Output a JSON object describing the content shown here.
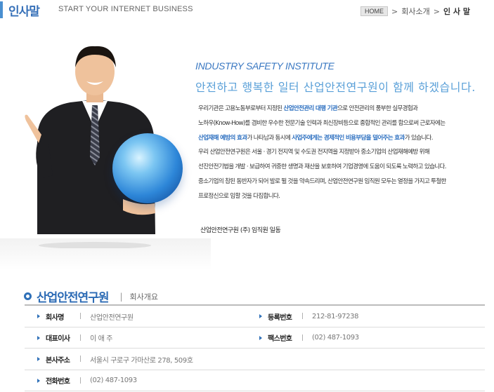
{
  "header": {
    "title": "인사말",
    "subtitle": "START YOUR INTERNET BUSINESS",
    "breadcrumb": {
      "home": "HOME",
      "parent": "회사소개",
      "current": "인 사 말"
    }
  },
  "hero": {
    "institute": "INDUSTRY SAFETY INSTITUTE",
    "headline": "안전하고 행복한 일터 산업안전연구원이 함께 하겠습니다.",
    "intro": {
      "l1a": "우리기관은 고용노동부로부터 지정된 ",
      "l1b": "산업안전관리 대행 기관",
      "l1c": "으로 안전관리의 풍부한 실무경험과",
      "l2": "노하우(Know-How)를 겸비한 우수한 전문기술 인력과 최신장비등으로 종합적인 관리를 함으로써 근로자에는",
      "l3a": "산업재해 예방의 효과",
      "l3b": "가 나타남과 동시에 ",
      "l3c": "사업주에게는 경제적인 비용부담을 덜어주는 효과",
      "l3d": "가 있습니다.",
      "l4": "우리 산업안전연구원은 서울 · 경기 전지역 및 수도권 전지역을 지정받아 중소기업의 산업재해예방 위해",
      "l5": "선진안전기법을 개발 · 보급하여 귀중한 생명과 재산을 보호하여 기업경영에 도움이 되도록 노력하고 있습니다.",
      "l6": "중소기업의 참된 동반자가 되어 발로 뛸 것을 약속드리며, 산업안전연구원 임직원 모두는 열정을 가지고 투철한",
      "l7": "프로정신으로 임할 것을 다짐합니다."
    },
    "signature": "산업안전연구원 (주) 임직원 일동"
  },
  "company": {
    "name": "산업안전연구원",
    "subtitle": "회사개요",
    "rows": [
      {
        "left": {
          "label": "회사명",
          "value": "산업안전연구원"
        },
        "right": {
          "label": "등록번호",
          "value": "212-81-97238"
        }
      },
      {
        "left": {
          "label": "대표이사",
          "value": "이 애 주"
        },
        "right": {
          "label": "팩스번호",
          "value": "(02) 487-1093"
        }
      },
      {
        "left": {
          "label": "본사주소",
          "value": "서울시 구로구 가마산로 278, 509호"
        }
      },
      {
        "left": {
          "label": "전화번호",
          "value": "(02) 487-1093"
        }
      }
    ]
  },
  "colors": {
    "accent": "#2f70b8",
    "highlight": "#2c6fc0",
    "headline": "#5aa0d8"
  },
  "icons": {
    "section": "ring-bullet-icon",
    "row": "triangle-arrow-icon"
  }
}
